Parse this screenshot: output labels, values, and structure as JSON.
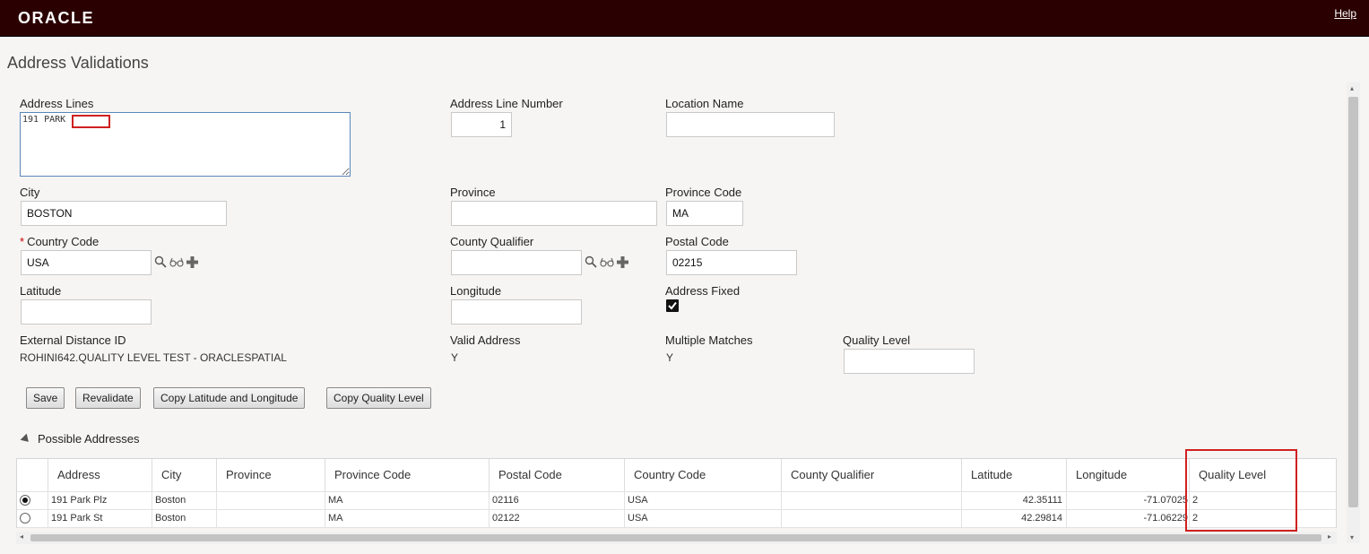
{
  "header": {
    "logo": "ORACLE",
    "help_link": "Help"
  },
  "page": {
    "title": "Address Validations"
  },
  "form": {
    "address_lines": {
      "label": "Address Lines",
      "value": "191 PARK"
    },
    "address_line_number": {
      "label": "Address Line Number",
      "value": "1"
    },
    "location_name": {
      "label": "Location Name",
      "value": ""
    },
    "city": {
      "label": "City",
      "value": "BOSTON"
    },
    "province": {
      "label": "Province",
      "value": ""
    },
    "province_code": {
      "label": "Province Code",
      "value": "MA"
    },
    "country_code": {
      "label": "Country Code",
      "required_mark": "*",
      "value": "USA"
    },
    "county_qualifier": {
      "label": "County Qualifier",
      "value": ""
    },
    "postal_code": {
      "label": "Postal Code",
      "value": "02215"
    },
    "latitude": {
      "label": "Latitude",
      "value": ""
    },
    "longitude": {
      "label": "Longitude",
      "value": ""
    },
    "address_fixed": {
      "label": "Address Fixed",
      "checked": true
    },
    "external_distance_id": {
      "label": "External Distance ID",
      "value": "ROHINI642.QUALITY LEVEL TEST - ORACLESPATIAL"
    },
    "valid_address": {
      "label": "Valid Address",
      "value": "Y"
    },
    "multiple_matches": {
      "label": "Multiple Matches",
      "value": "Y"
    },
    "quality_level": {
      "label": "Quality Level",
      "value": ""
    }
  },
  "buttons": {
    "save": "Save",
    "revalidate": "Revalidate",
    "copy_lat_long": "Copy Latitude and Longitude",
    "copy_quality": "Copy Quality Level"
  },
  "possible_addresses": {
    "title": "Possible Addresses",
    "columns": [
      "Address",
      "City",
      "Province",
      "Province Code",
      "Postal Code",
      "Country Code",
      "County Qualifier",
      "Latitude",
      "Longitude",
      "Quality Level"
    ],
    "rows": [
      {
        "selected": true,
        "address": "191 Park Plz",
        "city": "Boston",
        "province": "",
        "province_code": "MA",
        "postal_code": "02116",
        "country_code": "USA",
        "county_qualifier": "",
        "latitude": "42.35111",
        "longitude": "-71.07025",
        "quality_level": "2"
      },
      {
        "selected": false,
        "address": "191 Park St",
        "city": "Boston",
        "province": "",
        "province_code": "MA",
        "postal_code": "02122",
        "country_code": "USA",
        "county_qualifier": "",
        "latitude": "42.29814",
        "longitude": "-71.06229",
        "quality_level": "2"
      }
    ]
  },
  "icons": {
    "search": "magnifier-icon",
    "details": "glasses-icon",
    "add": "plus-icon"
  },
  "colors": {
    "header_bg": "#2b0000",
    "highlight": "#d02020"
  }
}
